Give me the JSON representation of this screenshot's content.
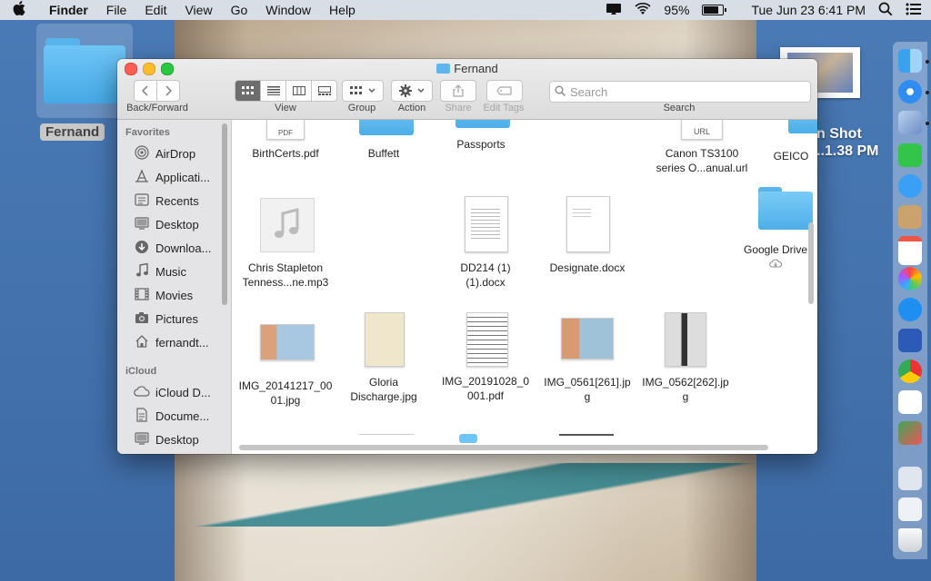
{
  "menubar": {
    "apple_icon": "apple-icon",
    "app_name": "Finder",
    "menus": [
      "File",
      "Edit",
      "View",
      "Go",
      "Window",
      "Help"
    ],
    "battery_percent": "95%",
    "clock": "Tue Jun 23  6:41 PM"
  },
  "desktop": {
    "folder_label": "Fernand",
    "screenshot_label_line1": "n Shot",
    "screenshot_label_line2": "..1.38 PM"
  },
  "window": {
    "title": "Fernand",
    "toolbar": {
      "back_forward_label": "Back/Forward",
      "view_label": "View",
      "group_label": "Group",
      "action_label": "Action",
      "share_label": "Share",
      "edit_tags_label": "Edit Tags",
      "search_label": "Search",
      "search_placeholder": "Search"
    },
    "sidebar": {
      "favorites_header": "Favorites",
      "favorites": [
        {
          "label": "AirDrop",
          "icon": "airdrop-icon"
        },
        {
          "label": "Applicati...",
          "icon": "applications-icon"
        },
        {
          "label": "Recents",
          "icon": "recents-icon"
        },
        {
          "label": "Desktop",
          "icon": "desktop-icon"
        },
        {
          "label": "Downloa...",
          "icon": "downloads-icon"
        },
        {
          "label": "Music",
          "icon": "music-icon"
        },
        {
          "label": "Movies",
          "icon": "movies-icon"
        },
        {
          "label": "Pictures",
          "icon": "pictures-icon"
        },
        {
          "label": "fernandt...",
          "icon": "home-icon"
        }
      ],
      "icloud_header": "iCloud",
      "icloud": [
        {
          "label": "iCloud D...",
          "icon": "icloud-drive-icon"
        },
        {
          "label": "Docume...",
          "icon": "documents-icon"
        },
        {
          "label": "Desktop",
          "icon": "desktop-icon"
        }
      ]
    },
    "files": [
      {
        "line1": "BirthCerts.pdf",
        "line2": "",
        "kind": "pdf",
        "badge": "PDF"
      },
      {
        "line1": "Buffett",
        "line2": "",
        "kind": "folder"
      },
      {
        "line1": "Passports",
        "line2": "",
        "kind": "folder"
      },
      {
        "line1": "Canon TS3100",
        "line2": "series O...anual.url",
        "kind": "url",
        "badge": "URL"
      },
      {
        "line1": "GEICO",
        "line2": "",
        "kind": "folder"
      },
      {
        "line1": "Chris Stapleton",
        "line2": "Tenness...ne.mp3",
        "kind": "audio"
      },
      {
        "line1": "DD214 (1)",
        "line2": "(1).docx",
        "kind": "docx"
      },
      {
        "line1": "Designate.docx",
        "line2": "",
        "kind": "docx"
      },
      {
        "line1": "Google Drive",
        "line2": "",
        "kind": "folder"
      },
      {
        "line1": "IMG_20141217_00",
        "line2": "01.jpg",
        "kind": "image"
      },
      {
        "line1": "Gloria",
        "line2": "Discharge.jpg",
        "kind": "image"
      },
      {
        "line1": "IMG_20191028_0",
        "line2": "001.pdf",
        "kind": "pdf"
      },
      {
        "line1": "IMG_0561[261].jp",
        "line2": "g",
        "kind": "image"
      },
      {
        "line1": "IMG_0562[262].jp",
        "line2": "g",
        "kind": "image"
      }
    ]
  }
}
